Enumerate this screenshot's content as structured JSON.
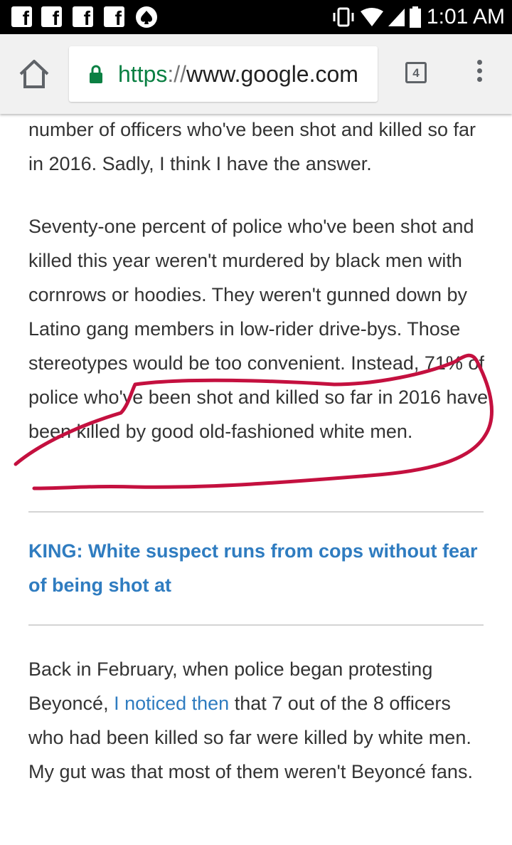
{
  "status_bar": {
    "notification_icons": [
      "facebook-icon",
      "facebook-icon",
      "facebook-icon",
      "facebook-icon",
      "kate-spade-icon"
    ],
    "time": "1:01 AM"
  },
  "browser": {
    "url_scheme": "https",
    "url_separator": "://",
    "url_host": "www.google.com",
    "tab_count": "4"
  },
  "article": {
    "para_top": "number of officers who've been shot and killed so far in 2016. Sadly, I think I have the answer.",
    "para_main": "Seventy-one percent of police who've been shot and killed this year weren't murdered by black men with cornrows or hoodies. They weren't gunned down by Latino gang members in low-rider drive-bys. Those stereotypes would be too convenient. Instead, 71% of police who've been shot and killed so far in 2016 have been killed by good old-fashioned white men.",
    "headline_link": "KING: White suspect runs from cops without fear of being shot at",
    "para_bottom_start": "Back in February, when police began protesting Beyoncé, ",
    "para_bottom_link": "I noticed then",
    "para_bottom_end": " that 7 out of the 8 officers who had been killed so far were killed by white men. My gut was that most of them weren't Beyoncé fans."
  },
  "colors": {
    "link": "#2f7cc0",
    "annotation": "#c4103f",
    "secure_green": "#0b8043"
  }
}
